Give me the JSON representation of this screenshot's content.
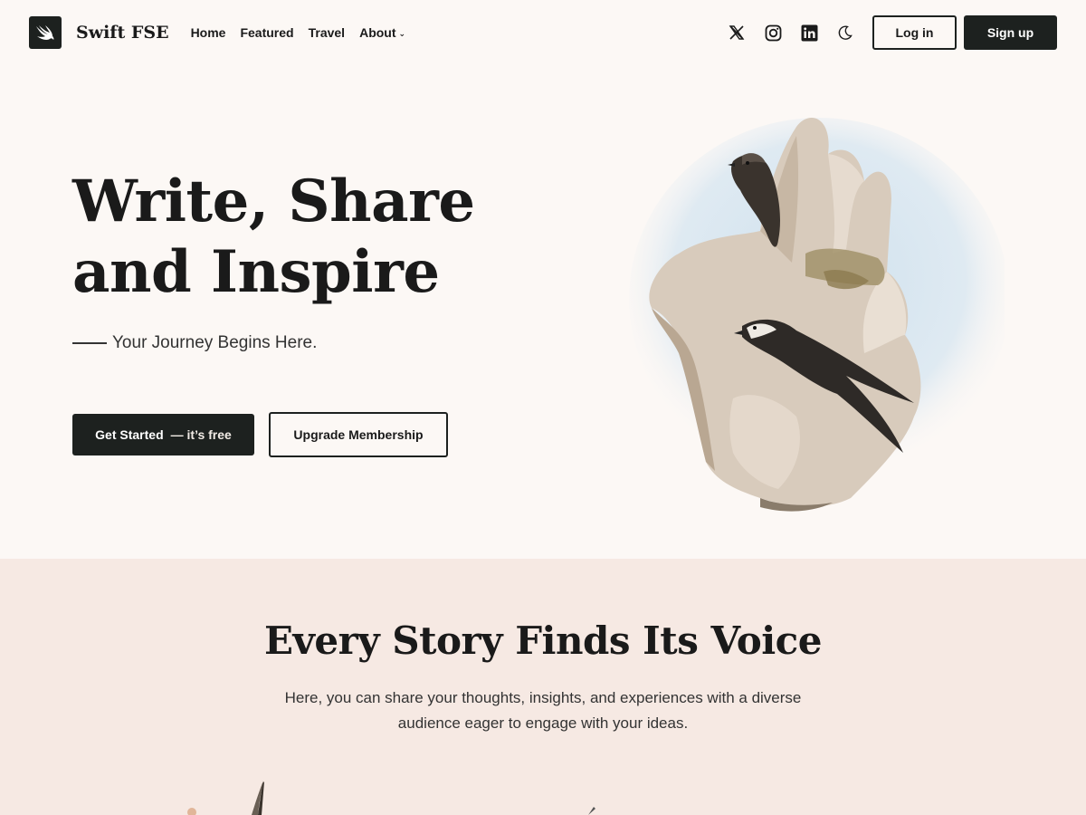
{
  "header": {
    "site_title": "Swift FSE",
    "logo_icon": "swift-bird-icon",
    "nav": [
      {
        "label": "Home"
      },
      {
        "label": "Featured"
      },
      {
        "label": "Travel"
      },
      {
        "label": "About"
      }
    ],
    "social_icons": [
      "x-icon",
      "instagram-icon",
      "linkedin-icon",
      "moon-icon"
    ],
    "login_label": "Log in",
    "signup_label": "Sign up"
  },
  "hero": {
    "title_line1": "Write, Share",
    "title_line2": "and Inspire",
    "subtitle": "Your Journey Begins Here.",
    "start_label": "Get Started",
    "start_suffix": "— it’s free",
    "upgrade_label": "Upgrade Membership"
  },
  "section2": {
    "title": "Every Story Finds Its Voice",
    "text": "Here, you can share your thoughts, insights, and experiences with a diverse audience eager to engage with your ideas."
  },
  "colors": {
    "page_bg": "#fcf8f5",
    "section_bg": "#f6e9e3",
    "primary": "#1d211f",
    "text": "#1a1a1a"
  }
}
